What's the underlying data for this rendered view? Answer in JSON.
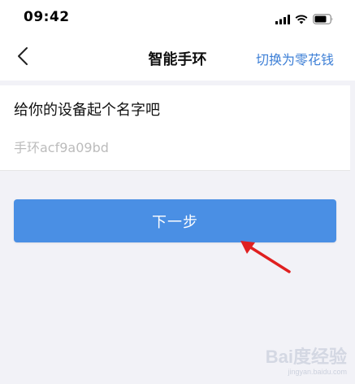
{
  "status_bar": {
    "time": "09:42",
    "icons": [
      "signal-icon",
      "wifi-icon",
      "battery-icon"
    ]
  },
  "nav": {
    "back_icon": "chevron-left-icon",
    "title": "智能手环",
    "action_label": "切换为零花钱"
  },
  "form": {
    "label": "给你的设备起个名字吧",
    "input_value": "",
    "input_placeholder": "手环acf9a09bd"
  },
  "next_button": {
    "label": "下一步"
  },
  "colors": {
    "accent": "#3d7fd6",
    "button": "#4a8fe4",
    "background": "#f2f2f7",
    "arrow": "#e02020"
  },
  "watermark": {
    "logo": "Bai度经验",
    "url": "jingyan.baidu.com"
  }
}
